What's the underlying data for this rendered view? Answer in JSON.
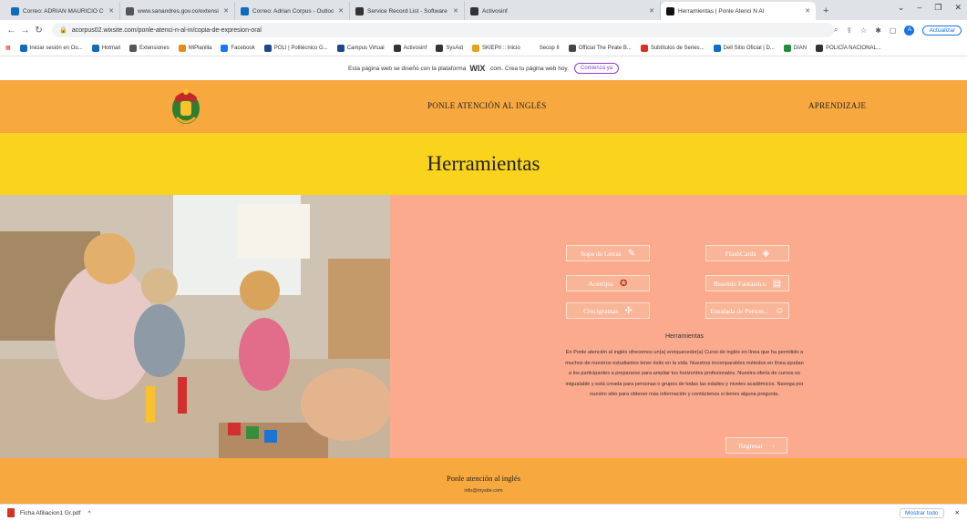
{
  "browser": {
    "tabs": [
      {
        "label": "Correo: ADRIAN MAURICIO COR",
        "color": "#0f6cbd"
      },
      {
        "label": "www.sanandres.gov.co/extension",
        "color": "#555555"
      },
      {
        "label": "Correo: Adrian Corpus - Outlook",
        "color": "#0f6cbd"
      },
      {
        "label": "Service Record List - Software de",
        "color": "#333333"
      },
      {
        "label": "Activosinf",
        "color": "#333333"
      },
      {
        "label": "Herramientas | Ponle Atenci N Al",
        "color": "#111111"
      }
    ],
    "url": "acorpus02.wixsite.com/ponle-atenci-n-al-in/copia-de-expresion-oral",
    "update_label": "Actualizar",
    "profile_initial": "A",
    "bookmarks": [
      {
        "label": "Iniciar sesión en Ou...",
        "color": "#0f6cbd"
      },
      {
        "label": "Hotmail",
        "color": "#0f6cbd"
      },
      {
        "label": "Extensiones",
        "color": "#555555"
      },
      {
        "label": "MiPlanilla",
        "color": "#e88a1a"
      },
      {
        "label": "Facebook",
        "color": "#1877f2"
      },
      {
        "label": "POLI | Politécnico G...",
        "color": "#1a4a8a"
      },
      {
        "label": "Campus Virtual",
        "color": "#1a4a8a"
      },
      {
        "label": "Activosinf",
        "color": "#333333"
      },
      {
        "label": "SysAid",
        "color": "#333333"
      },
      {
        "label": "SKIEPII :: Inicio",
        "color": "#e8a21a"
      },
      {
        "label": "Secop II",
        "color": "#ffffff"
      },
      {
        "label": "Official The Pirate B...",
        "color": "#444444"
      },
      {
        "label": "Subtítulos de Series...",
        "color": "#d93025"
      },
      {
        "label": "Dell Sitio Oficial | D...",
        "color": "#0b6fc4"
      },
      {
        "label": "DIAN",
        "color": "#1e8e3e"
      },
      {
        "label": "POLICÍA NACIONAL...",
        "color": "#333333"
      }
    ]
  },
  "wix_banner": {
    "text": "Esta página web se diseñó con la plataforma",
    "brand": "WIX",
    "suffix": ".com. Crea tu página web hoy.",
    "cta": "Comienza ya"
  },
  "site": {
    "nav": {
      "link1": "PONLE ATENCIÓN AL INGLÉS",
      "link2": "APRENDIZAJE"
    },
    "page_title": "Herramientas",
    "tools": [
      {
        "label": "Sopa de Letras",
        "icon": "pencil-icon"
      },
      {
        "label": "FlashCards",
        "icon": "layers-icon"
      },
      {
        "label": "Acertijos",
        "icon": "badge-check-icon"
      },
      {
        "label": "Bisemio Fantástico",
        "icon": "document-icon"
      },
      {
        "label": "Crucigramas",
        "icon": "grid-icon"
      },
      {
        "label": "Ensalada de Person...",
        "icon": "smiley-icon"
      }
    ],
    "panel_heading": "Herramientas",
    "panel_text": "En Ponle atención al inglés ofrecemos un(a) enriquecedor(a) Curso de inglés en línea que ha permitido a muchos de nuestros estudiantes tener éxito en la vida. Nuestros incomparables métodos en línea ayudan a los participantes a prepararse para ampliar tus horizontes profesionales. Nuestra oferta de cursos es inigualable y está creada para personas o grupos de todas las edades y niveles académicos. Navega por nuestro sitio para obtener más información y contáctenos si tienes alguna pregunta.",
    "back_label": "Regresar",
    "footer_title": "Ponle atención al inglés",
    "footer_email": "info@mysite.com"
  },
  "downloads": {
    "file": "Ficha Afiliacion1 Gr.pdf",
    "show_all": "Mostrar todo"
  }
}
